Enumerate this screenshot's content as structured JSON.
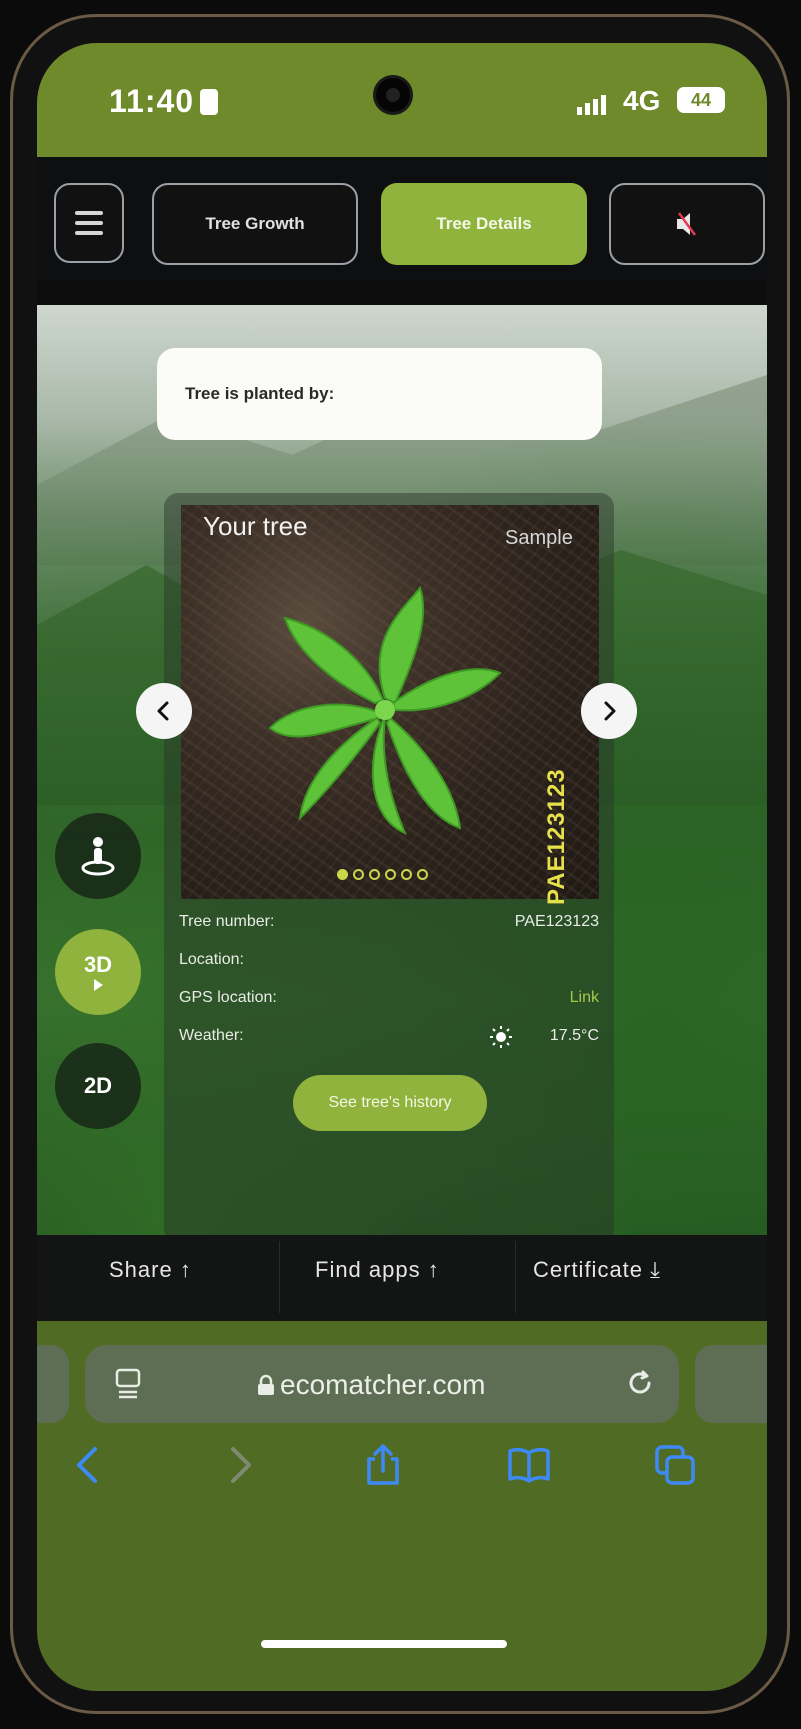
{
  "status_bar": {
    "time": "11:40",
    "network": "4G",
    "battery": "44"
  },
  "top_nav": {
    "tabs": [
      {
        "label": "Tree Growth",
        "active": false
      },
      {
        "label": "Tree Details",
        "active": true
      }
    ]
  },
  "planted_by": {
    "label": "Tree is planted by:"
  },
  "tree_card": {
    "title": "Your tree",
    "badge": "Sample",
    "tree_code": "PAE123123",
    "photo_count": 6,
    "active_photo": 1,
    "details": [
      {
        "label": "Tree number:",
        "value": "PAE123123"
      },
      {
        "label": "Location:",
        "value": ""
      },
      {
        "label": "GPS location:",
        "value": "Link"
      },
      {
        "label": "Weather:",
        "value": "17.5°C"
      }
    ],
    "history_button": "See tree's history"
  },
  "view_modes": {
    "three_d": "3D",
    "two_d": "2D"
  },
  "action_bar": {
    "share": "Share",
    "find_apps": "Find apps",
    "certificate": "Certificate"
  },
  "browser": {
    "url": "ecomatcher.com"
  },
  "colors": {
    "accent": "#8fb33c",
    "status_bar": "#6f8a2a",
    "nav_bg": "#0e0f10",
    "browser_chrome": "#506b23"
  }
}
